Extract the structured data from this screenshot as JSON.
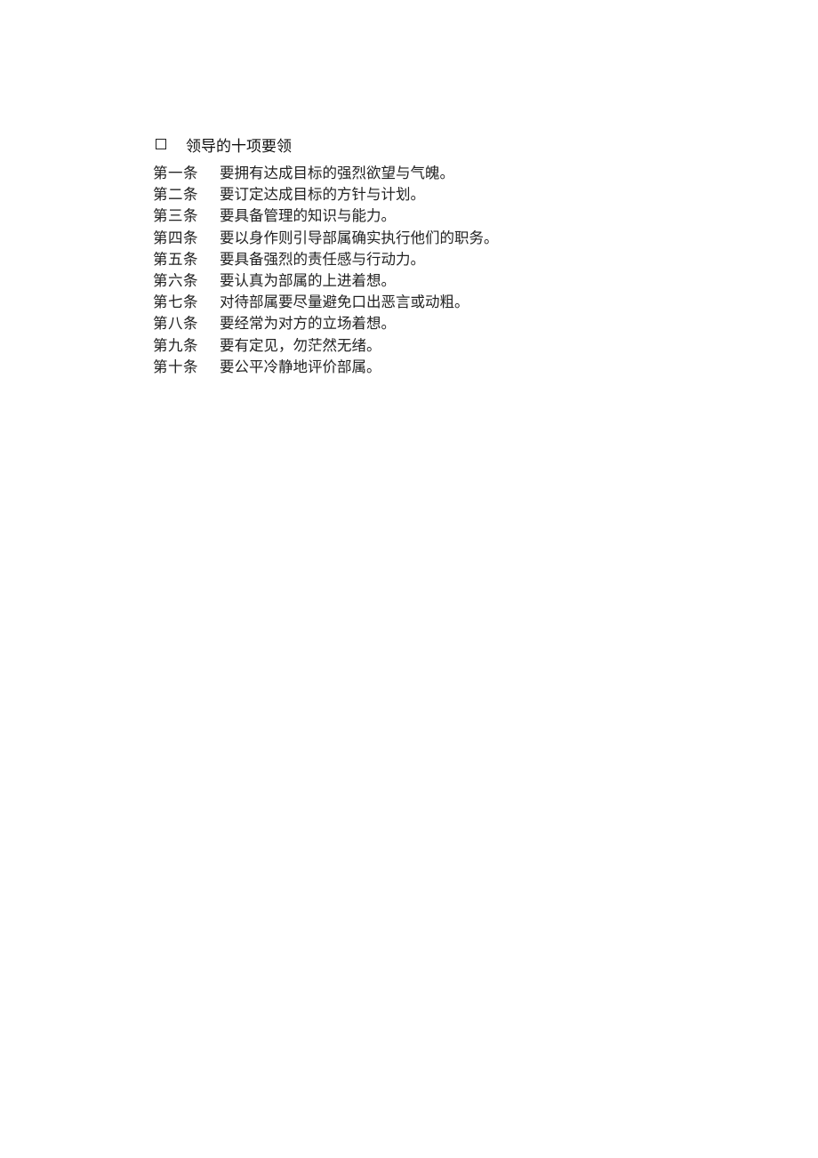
{
  "document": {
    "heading": {
      "checkbox_icon": "empty-square-icon",
      "checkbox_glyph": "",
      "title": "领导的十项要领"
    },
    "items": [
      {
        "number": "第一条",
        "text": "要拥有达成目标的强烈欲望与气魄。"
      },
      {
        "number": "第二条",
        "text": "要订定达成目标的方针与计划。"
      },
      {
        "number": "第三条",
        "text": "要具备管理的知识与能力。"
      },
      {
        "number": "第四条",
        "text": "要以身作则引导部属确实执行他们的职务。"
      },
      {
        "number": "第五条",
        "text": "要具备强烈的责任感与行动力。"
      },
      {
        "number": "第六条",
        "text": "要认真为部属的上进着想。"
      },
      {
        "number": "第七条",
        "text": "对待部属要尽量避免口出恶言或动粗。"
      },
      {
        "number": "第八条",
        "text": "要经常为对方的立场着想。"
      },
      {
        "number": "第九条",
        "text": "要有定见，勿茫然无绪。"
      },
      {
        "number": "第十条",
        "text": "要公平冷静地评价部属。"
      }
    ]
  }
}
